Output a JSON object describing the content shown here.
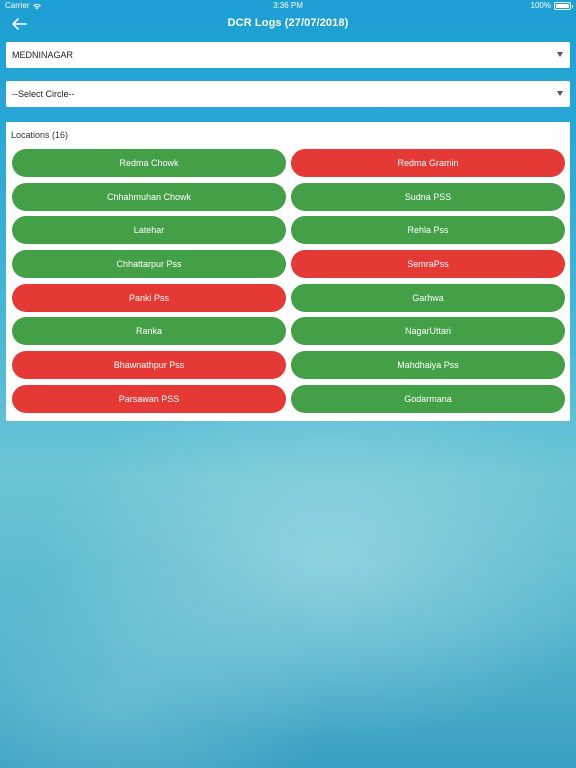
{
  "status_bar": {
    "carrier": "Carrier",
    "time": "3:36 PM",
    "battery": "100%"
  },
  "nav": {
    "title": "DCR Logs (27/07/2018)"
  },
  "division_select": {
    "value": "MEDNINAGAR"
  },
  "circle_select": {
    "value": "--Select Circle--"
  },
  "locations": {
    "header": "Locations (16)",
    "items": [
      {
        "label": "Redma Chowk",
        "status": "green"
      },
      {
        "label": "Redma Gramin",
        "status": "red"
      },
      {
        "label": "Chhahmuhan Chowk",
        "status": "green"
      },
      {
        "label": "Sudna PSS",
        "status": "green"
      },
      {
        "label": "Latehar",
        "status": "green"
      },
      {
        "label": "Rehla Pss",
        "status": "green"
      },
      {
        "label": "Chhattarpur Pss",
        "status": "green"
      },
      {
        "label": "SemraPss",
        "status": "red"
      },
      {
        "label": "Panki Pss",
        "status": "red"
      },
      {
        "label": "Garhwa",
        "status": "green"
      },
      {
        "label": "Ranka",
        "status": "green"
      },
      {
        "label": "NagarUttari",
        "status": "green"
      },
      {
        "label": "Bhawnathpur Pss",
        "status": "red"
      },
      {
        "label": "Mahdhaiya Pss",
        "status": "green"
      },
      {
        "label": "Parsawan PSS",
        "status": "red"
      },
      {
        "label": "Godarmana",
        "status": "green"
      }
    ]
  },
  "colors": {
    "green": "#43a047",
    "red": "#e53935",
    "nav_bg": "#1d9fd4"
  },
  "icons": {
    "back": "arrow-left-icon",
    "wifi": "wifi-icon",
    "battery": "battery-icon",
    "dropdown": "triangle-down-icon"
  }
}
